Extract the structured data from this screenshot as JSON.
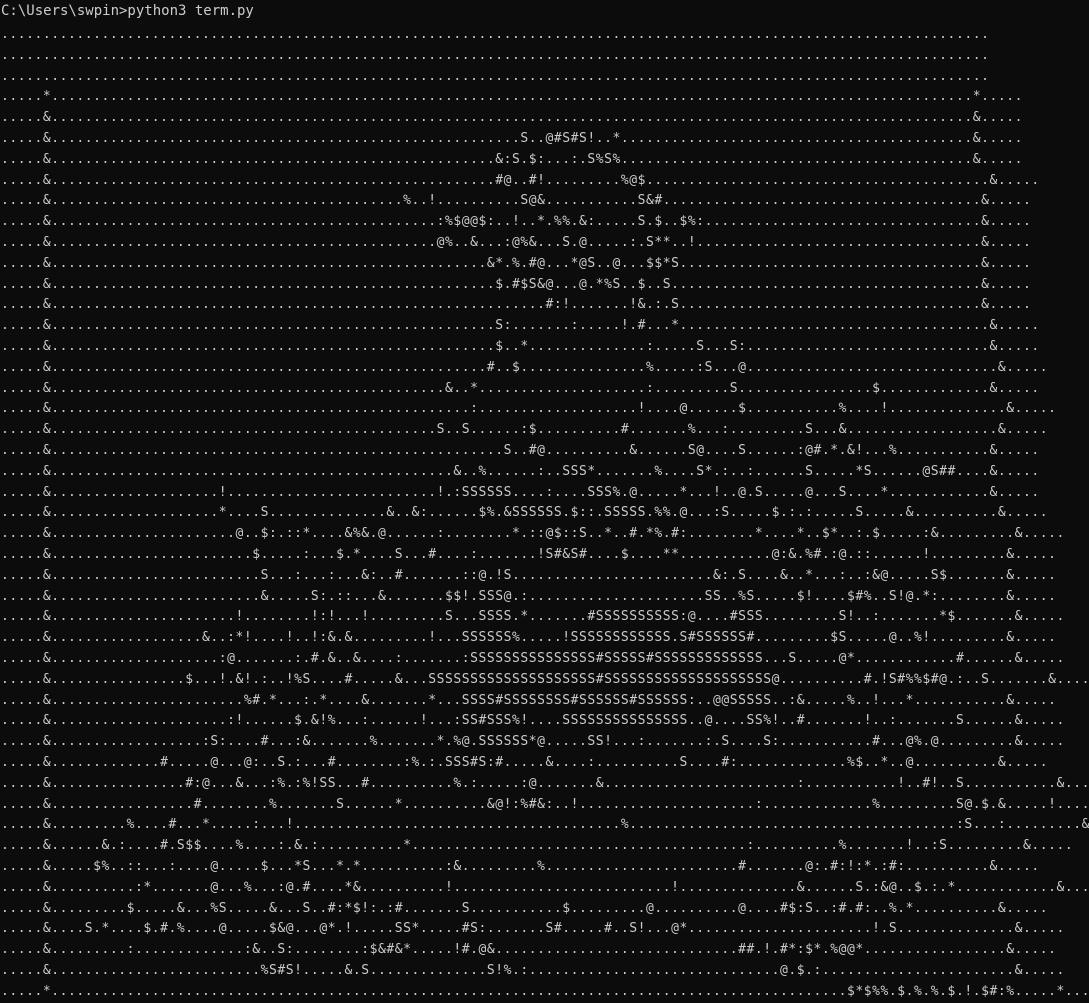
{
  "terminal": {
    "command_line": "C:\\Users\\swpin>python3 term.py",
    "background_color": "#0c0c0c",
    "text_color": "#cccccc",
    "output_lines": [
      "......................................................................................................................",
      "......................................................................................................................",
      "......................................................................................................................",
      ".....*..............................................................................................................*.....",
      ".....&..............................................................................................................&.....",
      ".....&........................................................S..@#S#S!..*..........................................&.....",
      ".....&.....................................................&:S.$:...:.S%S%..........................................&.....",
      ".....&.....................................................#@..#!.........%@$.........................................&.....",
      ".....&..........................................%..!..........S@&...........S&#......................................&.....",
      ".....&..............................................:%$@@$:..!..*.%%.&:.....S.$..$%:.................................&.....",
      ".....&..............................................@%..&...:@%&...S.@.....:.S**..!..................................&.....",
      ".....&....................................................&*.%.#@...*@S..@...$$*S....................................&.....",
      ".....&.....................................................$.#$S&@...@.*%S..$..S.....................................&.....",
      ".....&...........................................................#:!.......!&.:.S....................................&.....",
      ".....&.....................................................S:.......:.....!.#...*.....................................&.....",
      ".....&.....................................................$..*..............:.....S...S:.............................&.....",
      ".....&....................................................#..$...............%.....:S...@..............................&.....",
      ".....&...............................................&..*....................:.........S................$.............&.....",
      ".....&..................................................:...................!....@......$...........%....!..............&.....",
      ".....&..............................................S..S......:$..........#.......%...:.........S...&..................&.....",
      ".....&......................................................S..#@..........&......S@....S......:@#.*.&!...%...........&.....",
      ".....&................................................&..%......:..SSS*.......%....S*.:..:......S.....*S......@S##....&.....",
      ".....&....................!.........................!.:SSSSSS....:....SSS%.@.....*...!..@.S.....@...S....*............&.....",
      ".....&....................*....S..............&..&:......$%.&SSSSSS.$::.SSSSS.%%.@...:S.....$.:.:.....S.....&..........&.....",
      ".....&......................@..$:.::*....&%&.@......:........*.::@$::S..*..#.*%.#:........*....*..$*..:.$.....:&.........&.....",
      ".....&........................$.....:...$.*....S...#....:.......!S#&S#....$....**...........@:&.%#.:@.::......!.........&.....",
      ".....&.........................S...:...:...&:..#.......::@.!S........................&:.S....&..*...:..:&@.....S$.......&.....",
      ".....&.........................&.....S:.::...&.......$$!.SSS@.:.....................SS..%S.....$!....$#%..S!@.*:........&.....",
      ".....&......................!........!:!...!.........S...SSSS.*.......#SSSSSSSSSS:@....#SSS.........S!..:.......*$.......&.....",
      ".....&..................&..:*!....!..!:&.&.........!...SSSSSS%.....!SSSSSSSSSSSS.S#SSSSSS#.........$S.....@..%!.........&.....",
      ".....&....................:@.......:.#.&..&....:.......:SSSSSSSSSSSSSSS#SSSSS#SSSSSSSSSSSSS...S.....@*............#......&.....",
      ".....&................$...!.&!.:..!%S....#.....&...SSSSSSSSSSSSSSSSSSSS#SSSSSSSSSSSSSSSSSSSS@..........#.!S#%%$#@.:..S.......&.....",
      ".....&.......................%#.*...:.*....&.......*...SSSS#SSSSSSSS#SSSSSS#SSSSSS:..@@SSSSS..:&.....%..!...*...........&.....",
      ".....&.....................:!......$.&!%...:......!...:SS#SSS%!....SSSSSSSSSSSSSSS..@....SS%!..#.......!..:.......S......&.....",
      ".....&..................:S:....#...:&.......%.......*.%@.SSSSSS*@.....SS!...:.......:.S....S:...........#...@%.@.........&.....",
      ".....&.............#.....@...@:..S.:...#........:%.:.SSS#S:#.....&....:..........S....#:.............%$..*..@..........&.....",
      ".....&................#:@...&...:%.:%!SS...#..........%.:.....:@.......&.......................:...........!..#!..S...........&.....",
      ".....&.................#........%.......S......*..........&@!:%#&:..!.....................:.............%.........S@.$.&.....!........&.....",
      ".....&.........%....#...*.....:...!.......................................%.......................................:S...:.........&.....",
      ".....&......&.:....#.S$$....%....:.&.:..........*........................................:..........%.......!..:S.........&.....",
      ".....&.....$%..::...:....@.....$...*S...*.*..........:&.........%.......................#.......@:.#:!:*.:#:..........&.....",
      ".....&..........:*.......@...%...:@.#....*&..........!..........................!..............&......S.:&@..$.:.*............&.....",
      ".....&.........$.....&...%S.....&...S..#:*$!:.:#.......S...........$.........@..........@....#$:S..:#.#:..%.*..........&.....",
      ".....&....S.*....$.#.%....@.....$&@...@*.!.....SS*.....#S:.......S#.....#..S!...@*......................!.S..............&.....",
      ".....&.........:.............:&..S:........:$&#&*.....!#.@&.............................##.!.#*:$*.%@@*.................&.....",
      ".....&.........................%S#S!.....&.S..............S!%.:..............................@.$.:.......................&.....",
      ".....*...............................................................................................$*$%%.$.%.%.$.!.$#:%.....*.....",
      ".................................................................................................*.$:%.!$*!...*.!:$.:.@......"
    ]
  }
}
